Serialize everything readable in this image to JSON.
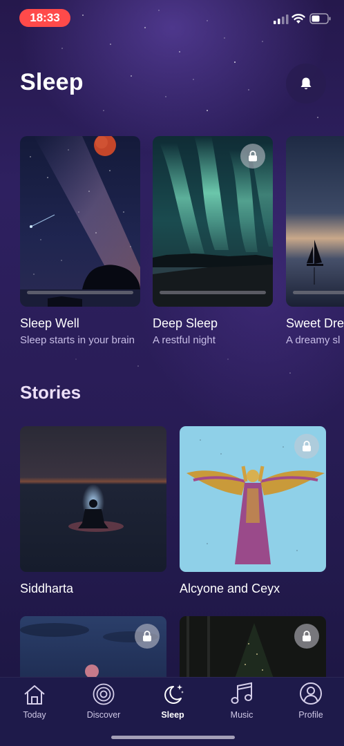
{
  "status_bar": {
    "time": "18:33"
  },
  "header": {
    "title": "Sleep"
  },
  "sleep_cards": [
    {
      "title": "Sleep Well",
      "subtitle": "Sleep starts in your brain",
      "locked": false,
      "progress_pct": 100
    },
    {
      "title": "Deep Sleep",
      "subtitle": "A restful night",
      "locked": true,
      "progress_pct": 100
    },
    {
      "title": "Sweet Dre",
      "subtitle": "A dreamy sl",
      "locked": false,
      "progress_pct": 100
    }
  ],
  "stories_section": {
    "title": "Stories",
    "items": [
      {
        "title": "Siddharta",
        "locked": false
      },
      {
        "title": "Alcyone and Ceyx",
        "locked": true
      },
      {
        "title": "",
        "locked": true
      },
      {
        "title": "",
        "locked": true
      }
    ]
  },
  "tab_bar": {
    "active": "Sleep",
    "tabs": [
      {
        "label": "Today",
        "icon": "home-icon"
      },
      {
        "label": "Discover",
        "icon": "discover-icon"
      },
      {
        "label": "Sleep",
        "icon": "moon-stars-icon"
      },
      {
        "label": "Music",
        "icon": "music-note-icon"
      },
      {
        "label": "Profile",
        "icon": "profile-icon"
      }
    ]
  },
  "colors": {
    "background_top": "#2e2060",
    "background_bottom": "#1b1540",
    "time_pill": "#ff4a4a",
    "subtitle_text": "#c7bde6",
    "tab_bar": "#1e1a4a"
  }
}
